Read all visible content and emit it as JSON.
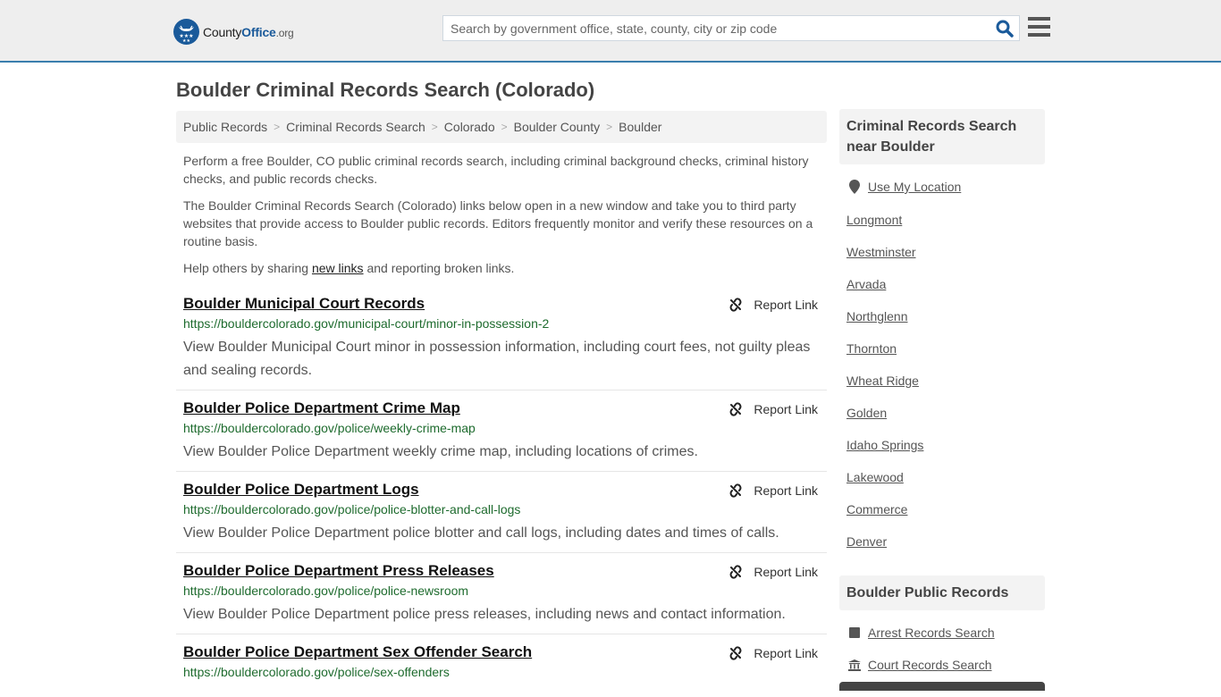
{
  "header": {
    "logo": {
      "brand": "County",
      "brand_accent": "Office",
      "tld": ".org"
    },
    "search": {
      "placeholder": "Search by government office, state, county, city or zip code",
      "value": ""
    },
    "colors": {
      "brand_blue": "#1a5a9a",
      "header_border": "#3a7ead",
      "url_green": "#1e6b2e"
    }
  },
  "page": {
    "title": "Boulder Criminal Records Search (Colorado)",
    "breadcrumb": [
      "Public Records",
      "Criminal Records Search",
      "Colorado",
      "Boulder County",
      "Boulder"
    ],
    "intro": {
      "p1": "Perform a free Boulder, CO public criminal records search, including criminal background checks, criminal history checks, and public records checks.",
      "p2": "The Boulder Criminal Records Search (Colorado) links below open in a new window and take you to third party websites that provide access to Boulder public records. Editors frequently monitor and verify these resources on a routine basis.",
      "p3_before": "Help others by sharing ",
      "p3_link": "new links",
      "p3_after": " and reporting broken links."
    },
    "report_label": "Report Link",
    "results": [
      {
        "title": "Boulder Municipal Court Records",
        "url": "https://bouldercolorado.gov/municipal-court/minor-in-possession-2",
        "desc": "View Boulder Municipal Court minor in possession information, including court fees, not guilty pleas and sealing records."
      },
      {
        "title": "Boulder Police Department Crime Map",
        "url": "https://bouldercolorado.gov/police/weekly-crime-map",
        "desc": "View Boulder Police Department weekly crime map, including locations of crimes."
      },
      {
        "title": "Boulder Police Department Logs",
        "url": "https://bouldercolorado.gov/police/police-blotter-and-call-logs",
        "desc": "View Boulder Police Department police blotter and call logs, including dates and times of calls."
      },
      {
        "title": "Boulder Police Department Press Releases",
        "url": "https://bouldercolorado.gov/police/police-newsroom",
        "desc": "View Boulder Police Department police press releases, including news and contact information."
      },
      {
        "title": "Boulder Police Department Sex Offender Search",
        "url": "https://bouldercolorado.gov/police/sex-offenders",
        "desc": ""
      }
    ]
  },
  "sidebar": {
    "nearby": {
      "heading": "Criminal Records Search near Boulder",
      "use_location": "Use My Location",
      "cities": [
        "Longmont",
        "Westminster",
        "Arvada",
        "Northglenn",
        "Thornton",
        "Wheat Ridge",
        "Golden",
        "Idaho Springs",
        "Lakewood",
        "Commerce",
        "Denver"
      ]
    },
    "public_records": {
      "heading": "Boulder Public Records",
      "links": [
        {
          "label": "Arrest Records Search",
          "icon": "square-icon"
        },
        {
          "label": "Court Records Search",
          "icon": "courthouse-icon"
        }
      ]
    }
  }
}
